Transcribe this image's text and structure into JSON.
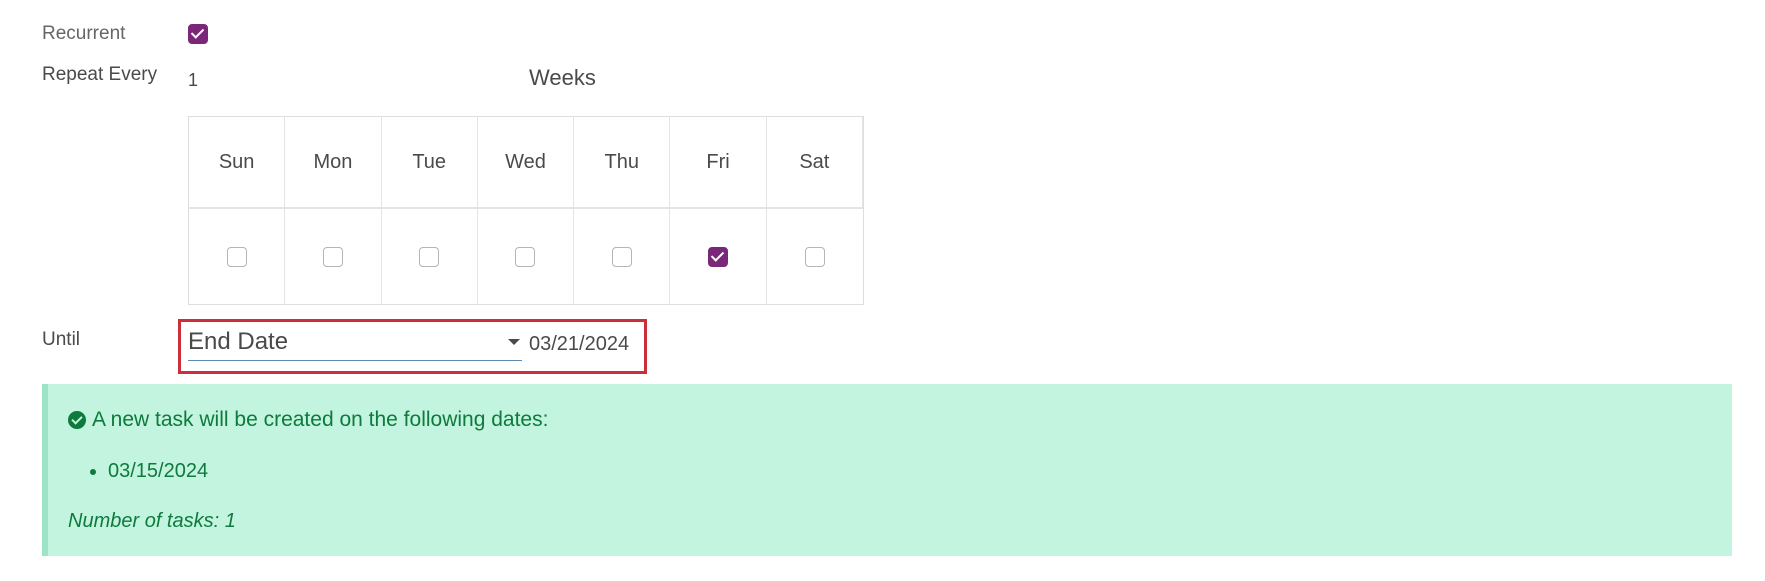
{
  "recurrent": {
    "label": "Recurrent",
    "checked": true
  },
  "repeat": {
    "label": "Repeat Every",
    "interval": "1",
    "unit": "Weeks"
  },
  "days": [
    {
      "label": "Sun",
      "checked": false
    },
    {
      "label": "Mon",
      "checked": false
    },
    {
      "label": "Tue",
      "checked": false
    },
    {
      "label": "Wed",
      "checked": false
    },
    {
      "label": "Thu",
      "checked": false
    },
    {
      "label": "Fri",
      "checked": true
    },
    {
      "label": "Sat",
      "checked": false
    }
  ],
  "until": {
    "label": "Until",
    "mode": "End Date",
    "date": "03/21/2024"
  },
  "alert": {
    "message": "A new task will be created on the following dates:",
    "dates": [
      "03/15/2024"
    ],
    "count_text": "Number of tasks: 1"
  },
  "colors": {
    "accent": "#7b2779",
    "highlight": "#cc2f3a",
    "success_bg": "#c2f4e0",
    "success_text": "#0e7a3b"
  }
}
